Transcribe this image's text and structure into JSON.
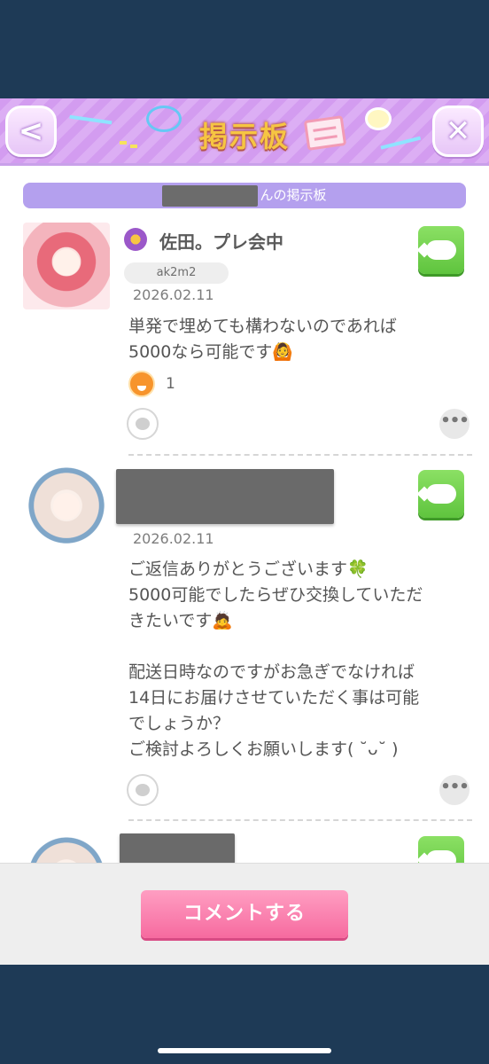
{
  "header": {
    "title": "掲示板",
    "back_icon": "chevron-left-icon",
    "close_icon": "close-x-icon"
  },
  "board": {
    "name_suffix": "んの掲示板"
  },
  "posts": [
    {
      "author": "佐田。プレ会中",
      "user_id": "ak2m2",
      "date": "2026.02.11",
      "body": "単発で埋めても構わないのであれば\n5000なら可能です🙆",
      "reaction_count": "1"
    },
    {
      "author": "",
      "date": "2026.02.11",
      "body": "ご返信ありがとうございます🍀\n5000可能でしたらぜひ交換していただ\nきたいです🙇\n\n配送日時なのですがお急ぎでなければ\n14日にお届けさせていただく事は可能\nでしょうか？\nご検討よろしくお願いします( ˘ᴗ˘ )"
    }
  ],
  "more_label": "•••",
  "footer": {
    "comment_label": "コメントする"
  },
  "colors": {
    "header_bg": "#d39cf0",
    "title_color": "#f6c542",
    "board_bar": "#b4a0ee",
    "reply_green": "#6ccd48",
    "comment_pink": "#f67aa8",
    "frame_bg": "#1e3a56"
  }
}
